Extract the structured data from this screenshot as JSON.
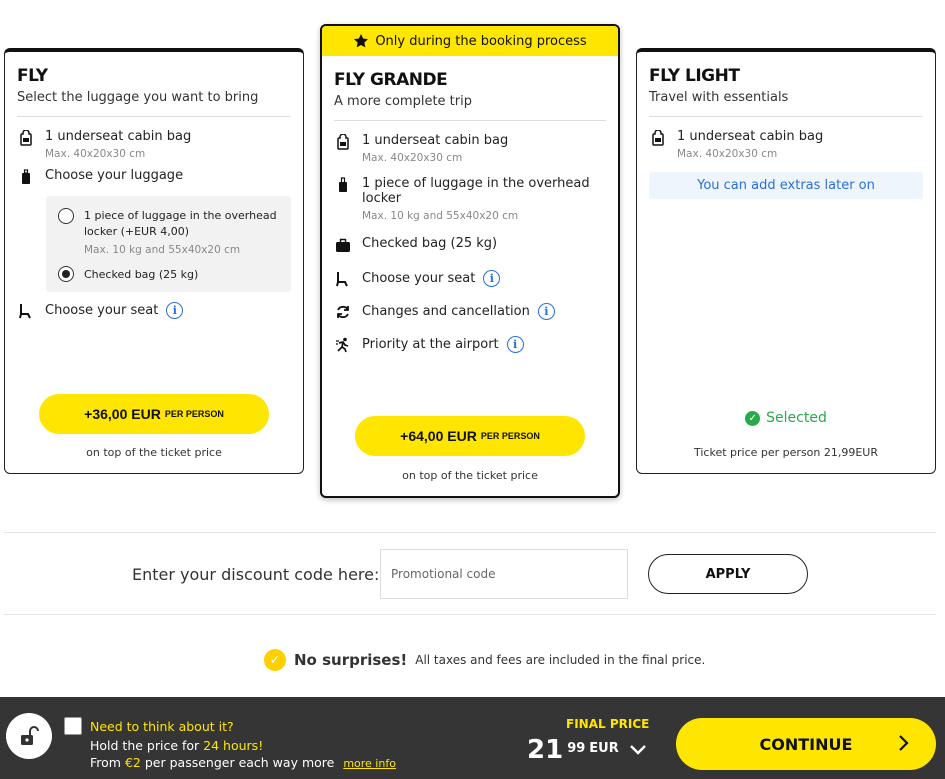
{
  "fares": {
    "fly": {
      "title": "FLY",
      "subtitle": "Select the luggage you want to bring",
      "features": [
        {
          "label": "1 underseat cabin bag",
          "note": "Max. 40x20x30 cm"
        },
        {
          "label": "Choose your luggage"
        },
        {
          "label": "Choose your seat"
        }
      ],
      "options": [
        {
          "label": "1 piece of luggage in the overhead locker (+EUR 4,00)",
          "note": "Max. 10 kg and 55x40x20 cm",
          "selected": false
        },
        {
          "label": "Checked bag (25 kg)",
          "selected": true
        }
      ],
      "price": "+36,00 EUR",
      "per_person": "PER PERSON",
      "price_note": "on top of the ticket price"
    },
    "grande": {
      "ribbon": "Only during the booking process",
      "title": "FLY GRANDE",
      "subtitle": "A more complete trip",
      "features": [
        {
          "label": "1 underseat cabin bag",
          "note": "Max. 40x20x30 cm"
        },
        {
          "label": "1 piece of luggage in the overhead locker",
          "note": "Max. 10 kg and 55x40x20 cm"
        },
        {
          "label": "Checked bag (25 kg)"
        },
        {
          "label": "Choose your seat"
        },
        {
          "label": "Changes and cancellation"
        },
        {
          "label": "Priority at the airport"
        }
      ],
      "price": "+64,00 EUR",
      "per_person": "PER PERSON",
      "price_note": "on top of the ticket price"
    },
    "light": {
      "title": "FLY LIGHT",
      "subtitle": "Travel with essentials",
      "features": [
        {
          "label": "1 underseat cabin bag",
          "note": "Max. 40x20x30 cm"
        }
      ],
      "extras": "You can add extras later on",
      "selected_label": "Selected",
      "price_note": "Ticket price per person 21,99EUR"
    }
  },
  "discount": {
    "label": "Enter your discount code here:",
    "placeholder": "Promotional code",
    "apply": "APPLY"
  },
  "no_surprises": {
    "bold": "No surprises!",
    "text": "All taxes and fees are included in the final price."
  },
  "footer": {
    "think": "Need to think about it?",
    "hold_prefix": "Hold the price for",
    "hold_highlight": "24 hours!",
    "from_prefix": "From",
    "from_highlight": "€2",
    "from_suffix": "per passenger each way more",
    "more_info": "more info",
    "final_label": "FINAL PRICE",
    "price_int": "21",
    "price_dec": "99",
    "currency": "EUR",
    "continue": "CONTINUE"
  },
  "colors": {
    "accent": "#ffe600",
    "info_blue": "#2a6fd6",
    "success": "#2aa84a",
    "footer_bg": "#353535"
  }
}
